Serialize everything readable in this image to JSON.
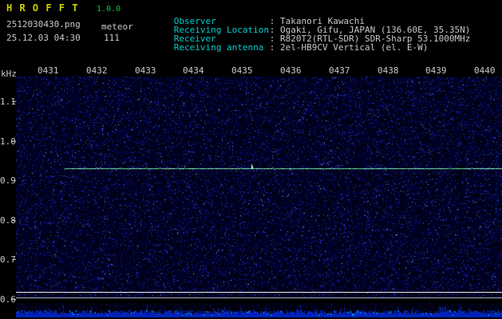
{
  "header": {
    "title": "H R O F F T",
    "version": "1.0.0",
    "filename": "2512030430.png",
    "mode": "meteor",
    "datetime": "25.12.03 04:30",
    "echo_count": "111",
    "info_rows": [
      {
        "label": "Observer",
        "value": ": Takanori Kawachi"
      },
      {
        "label": "Receiving Location",
        "value": ": Ogaki, Gifu, JAPAN (136.60E, 35.35N)"
      },
      {
        "label": "Receiver",
        "value": ": R820T2(RTL-SDR) SDR-Sharp 53.1000MHz"
      },
      {
        "label": "Receiving antenna",
        "value": ": 2el-HB9CV Vertical (el. E-W)"
      }
    ]
  },
  "chart_data": {
    "type": "heatmap",
    "title": "HROFFT 10-minute meteor radio observation spectrogram",
    "x_ticks": [
      "0431",
      "0432",
      "0433",
      "0434",
      "0435",
      "0436",
      "0437",
      "0438",
      "0439",
      "0440"
    ],
    "x_range": [
      "04:30",
      "04:40"
    ],
    "ylabel": "kHz",
    "y_ticks": [
      "1.1",
      "1.0",
      "0.9",
      "0.8",
      "0.7",
      "0.6"
    ],
    "y_range_khz": [
      0.6,
      1.16
    ],
    "carrier": {
      "frequency_khz": 0.93,
      "visible_from": "04:31",
      "visible_to": "04:40",
      "spike_time_approx": "04:34.8"
    },
    "background": "random dark-blue noise speckle",
    "bottom_strip": "signal-level bar noise over the same 10-minute span"
  },
  "colors": {
    "title_yellow": "#cfcf00",
    "version_green": "#00cc33",
    "label_cyan": "#00cccc",
    "text_white": "#c8c8c8",
    "carrier_green": "#88eeaa"
  },
  "render": {
    "spec_bg": "#000012",
    "noise_colors": [
      "#000042",
      "#00006a",
      "#101e90",
      "#2233cc",
      "#4466ee",
      "#77ccff"
    ],
    "noise_density": 0.32,
    "carrier_y": 115,
    "carrier_start_x": 60,
    "spike_x": 295,
    "carrier_colors": [
      "#66dd99",
      "#99ffcc",
      "#ddffee"
    ],
    "strip_bg": "#000010",
    "strip_colors": [
      "#0022bb",
      "#2244ee",
      "#00bbff"
    ]
  }
}
